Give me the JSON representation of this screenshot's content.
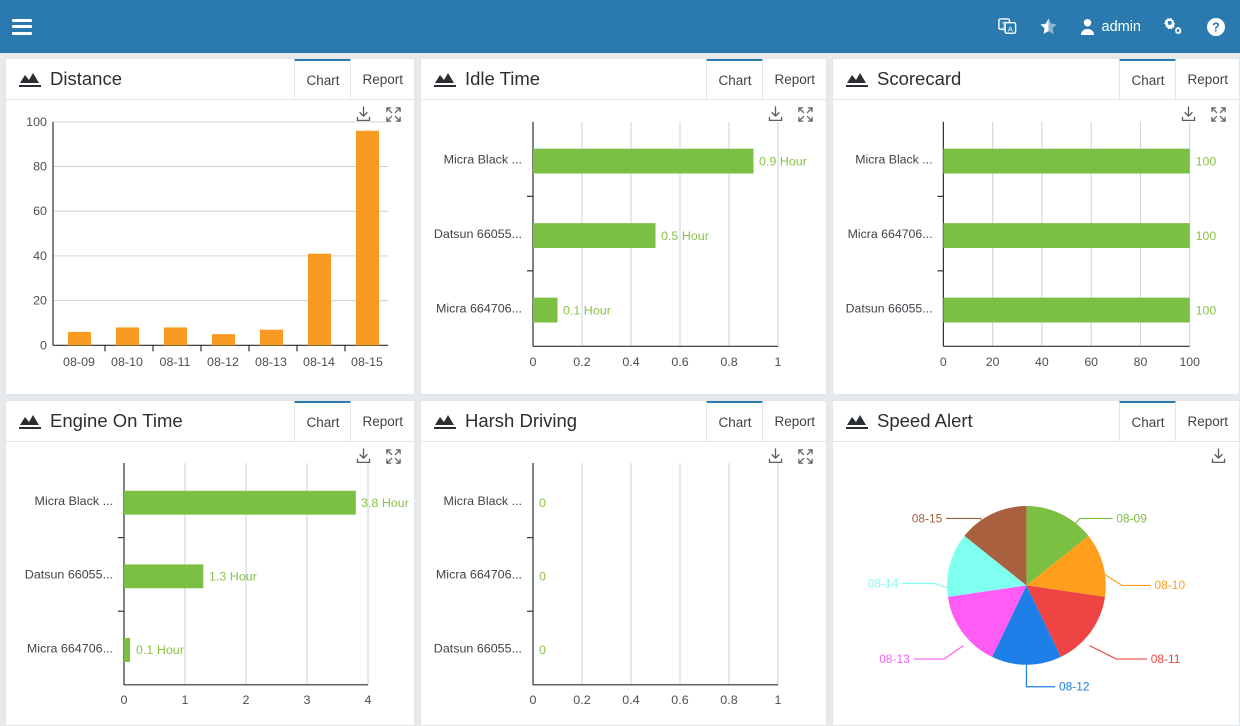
{
  "navbar": {
    "menu_icon": "hamburger-icon",
    "items": [
      {
        "name": "language-icon",
        "label": ""
      },
      {
        "name": "star-icon",
        "label": ""
      },
      {
        "name": "user-icon",
        "label": "admin"
      },
      {
        "name": "settings-gears-icon",
        "label": ""
      },
      {
        "name": "help-icon",
        "label": ""
      }
    ],
    "user_label": "admin",
    "bg_color": "#2a7ab0"
  },
  "tabs": {
    "chart": "Chart",
    "report": "Report"
  },
  "tools": {
    "download": "download-icon",
    "expand": "expand-icon"
  },
  "cards": [
    {
      "title": "Distance",
      "icon": "area-chart-icon",
      "has_expand": true
    },
    {
      "title": "Idle Time",
      "icon": "area-chart-icon",
      "has_expand": true
    },
    {
      "title": "Scorecard",
      "icon": "area-chart-icon",
      "has_expand": true
    },
    {
      "title": "Engine On Time",
      "icon": "area-chart-icon",
      "has_expand": true
    },
    {
      "title": "Harsh Driving",
      "icon": "area-chart-icon",
      "has_expand": true
    },
    {
      "title": "Speed Alert",
      "icon": "area-chart-icon",
      "has_expand": false
    }
  ],
  "chart_data": [
    {
      "type": "bar",
      "title": "Distance",
      "orientation": "vertical",
      "categories": [
        "08-09",
        "08-10",
        "08-11",
        "08-12",
        "08-13",
        "08-14",
        "08-15"
      ],
      "values": [
        6,
        8,
        8,
        5,
        7,
        41,
        96
      ],
      "yticks": [
        0,
        20,
        40,
        60,
        80,
        100
      ],
      "ylim": [
        0,
        100
      ],
      "xlabel": "",
      "ylabel": "",
      "grid": true,
      "color": "#f79a1f"
    },
    {
      "type": "bar",
      "title": "Idle Time",
      "orientation": "horizontal",
      "categories": [
        "Micra Black ...",
        "Datsun 66055...",
        "Micra 664706..."
      ],
      "values": [
        0.9,
        0.5,
        0.1
      ],
      "value_labels": [
        "0.9 Hour",
        "0.5 Hour",
        "0.1 Hour"
      ],
      "xticks": [
        0,
        0.2,
        0.4,
        0.6,
        0.8,
        1
      ],
      "xlim": [
        0,
        1
      ],
      "unit": "Hour",
      "grid": true,
      "color": "#7cc043"
    },
    {
      "type": "bar",
      "title": "Scorecard",
      "orientation": "horizontal",
      "categories": [
        "Micra Black ...",
        "Micra 664706...",
        "Datsun 66055..."
      ],
      "values": [
        100,
        100,
        100
      ],
      "value_labels": [
        "100",
        "100",
        "100"
      ],
      "xticks": [
        0,
        20,
        40,
        60,
        80,
        100
      ],
      "xlim": [
        0,
        100
      ],
      "unit": "",
      "grid": true,
      "color": "#7cc043"
    },
    {
      "type": "bar",
      "title": "Engine On Time",
      "orientation": "horizontal",
      "categories": [
        "Micra Black ...",
        "Datsun 66055...",
        "Micra 664706..."
      ],
      "values": [
        3.8,
        1.3,
        0.1
      ],
      "value_labels": [
        "3.8 Hour",
        "1.3 Hour",
        "0.1 Hour"
      ],
      "xticks": [
        0,
        1,
        2,
        3,
        4
      ],
      "xlim": [
        0,
        4
      ],
      "unit": "Hour",
      "grid": true,
      "color": "#7cc043"
    },
    {
      "type": "bar",
      "title": "Harsh Driving",
      "orientation": "horizontal",
      "categories": [
        "Micra Black ...",
        "Micra 664706...",
        "Datsun 66055..."
      ],
      "values": [
        0,
        0,
        0
      ],
      "value_labels": [
        "0",
        "0",
        "0"
      ],
      "xticks": [
        0,
        0.2,
        0.4,
        0.6,
        0.8,
        1
      ],
      "xlim": [
        0,
        1
      ],
      "unit": "",
      "grid": true,
      "color": "#7cc043"
    },
    {
      "type": "pie",
      "title": "Speed Alert",
      "labels": [
        "08-09",
        "08-10",
        "08-11",
        "08-12",
        "08-13",
        "08-14",
        "08-15"
      ],
      "values": [
        1,
        1,
        1,
        1,
        1,
        1,
        1
      ],
      "percents": [
        14.29,
        14.29,
        14.29,
        14.29,
        14.29,
        14.29,
        14.29
      ],
      "colors": [
        "#7cc043",
        "#ff9f1c",
        "#ef4444",
        "#1f7fe8",
        "#ff5cf5",
        "#7ffff0",
        "#a9603e"
      ],
      "legend": "labels-outside"
    }
  ]
}
